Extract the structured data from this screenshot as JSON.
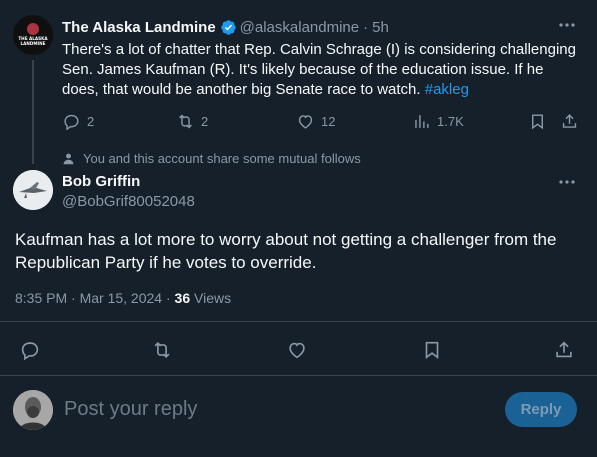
{
  "parent_tweet": {
    "author_name": "The Alaska Landmine",
    "author_handle": "@alaskalandmine",
    "time_sep": "·",
    "time": "5h",
    "avatar_text": "THE ALASKA LANDMINE",
    "text_main": "There's a lot of chatter that Rep. Calvin Schrage (I) is considering challenging Sen. James Kaufman (R). It's likely because of the education issue. If he does, that would be another big Senate race to watch. ",
    "hashtag": "#akleg",
    "replies": "2",
    "reposts": "2",
    "likes": "12",
    "views": "1.7K"
  },
  "mutual_follows": "You and this account share some mutual follows",
  "reply_tweet": {
    "author_name": "Bob Griffin",
    "author_handle": "@BobGrif80052048",
    "text": "Kaufman has a lot more to worry about not getting a challenger from the Republican Party if he votes to override.",
    "timestamp": "8:35 PM · Mar 15, 2024 · ",
    "views_count": "36",
    "views_label": " Views"
  },
  "composer": {
    "placeholder": "Post your reply",
    "reply_button": "Reply"
  },
  "colors": {
    "background": "#15202b",
    "accent": "#1d9bf0",
    "muted": "#8b98a5",
    "divider": "#38444d"
  },
  "icons": [
    "verified-badge-icon",
    "more-icon",
    "reply-icon",
    "repost-icon",
    "like-icon",
    "views-icon",
    "bookmark-icon",
    "share-icon",
    "person-icon"
  ]
}
